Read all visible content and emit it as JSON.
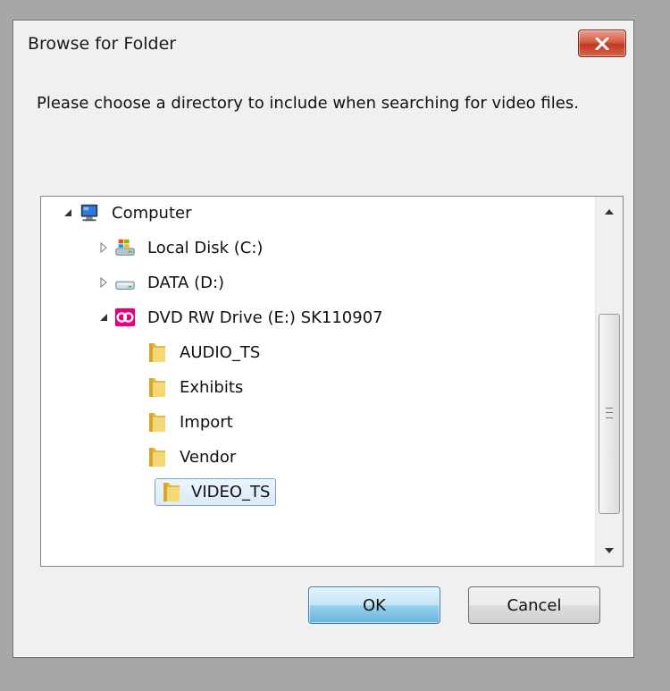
{
  "dialog": {
    "title": "Browse for Folder",
    "close_label": "close",
    "message": "Please choose a directory to include when searching for video files."
  },
  "tree": {
    "nodes": [
      {
        "label": "Computer",
        "icon": "computer-icon",
        "expander": "expanded"
      },
      {
        "label": "Local Disk (C:)",
        "icon": "local-disk-icon",
        "expander": "collapsed"
      },
      {
        "label": "DATA (D:)",
        "icon": "drive-icon",
        "expander": "collapsed"
      },
      {
        "label": "DVD RW Drive (E:) SK110907",
        "icon": "dvd-drive-icon",
        "expander": "expanded"
      },
      {
        "label": "AUDIO_TS",
        "icon": "folder-icon",
        "expander": "none"
      },
      {
        "label": "Exhibits",
        "icon": "folder-icon",
        "expander": "none"
      },
      {
        "label": "Import",
        "icon": "folder-icon",
        "expander": "none"
      },
      {
        "label": "Vendor",
        "icon": "folder-icon",
        "expander": "none"
      },
      {
        "label": "VIDEO_TS",
        "icon": "folder-icon",
        "expander": "none",
        "selected": true
      }
    ]
  },
  "buttons": {
    "ok_label": "OK",
    "cancel_label": "Cancel"
  },
  "colors": {
    "close_button": "#c94a2f",
    "ok_button": "#98d1ef",
    "selection_border": "#7da2ce"
  }
}
